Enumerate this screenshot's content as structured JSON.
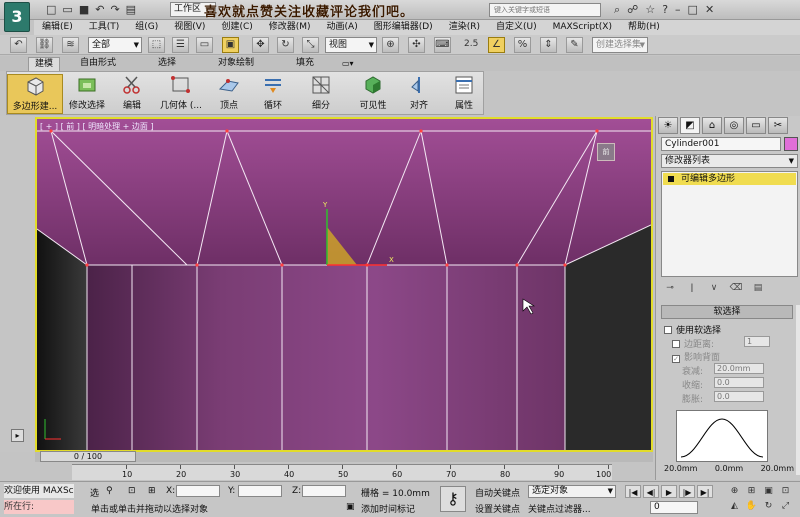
{
  "title_bar": {
    "app_logo": "3",
    "workspace_label": "工作区",
    "overlay_caption": "喜欢就点赞关注收藏评论我们吧。",
    "search_placeholder": "键入关键字或短语"
  },
  "menu": {
    "items": [
      "编辑(E)",
      "工具(T)",
      "组(G)",
      "视图(V)",
      "创建(C)",
      "修改器(M)",
      "动画(A)",
      "图形编辑器(D)",
      "渲染(R)",
      "自定义(U)",
      "MAXScript(X)",
      "帮助(H)"
    ]
  },
  "toolbar": {
    "selection_filter": "全部",
    "coord_system": "视图",
    "snap_value": "2.5",
    "named_selection_placeholder": "创建选择集"
  },
  "ribbon": {
    "tabs": [
      "建模",
      "自由形式",
      "选择",
      "对象绘制",
      "填充"
    ],
    "active_tab": "建模",
    "buttons": [
      {
        "label": "多边形建..."
      },
      {
        "label": "修改选择"
      },
      {
        "label": "编辑"
      },
      {
        "label": "几何体 (..."
      },
      {
        "label": "顶点"
      },
      {
        "label": "循环"
      },
      {
        "label": "细分"
      },
      {
        "label": "可见性"
      },
      {
        "label": "对齐"
      },
      {
        "label": "属性"
      }
    ]
  },
  "viewport": {
    "label": "[ + ] [ 前 ] [ 明暗处理 + 边面 ]",
    "viewcube_label": "前"
  },
  "command_panel": {
    "object_name": "Cylinder001",
    "object_color": "#e06fd8",
    "modifier_list": "修改器列表",
    "stack_item": "可编辑多边形",
    "rollout_title": "软选择",
    "use_soft_selection": "使用软选择",
    "edge_distance_label": "边距离:",
    "edge_distance_value": "1",
    "affect_backfacing": "影响背面",
    "falloff_label": "衰减:",
    "falloff_value": "20.0mm",
    "pinch_label": "收缩:",
    "pinch_value": "0.0",
    "bubble_label": "膨胀:",
    "bubble_value": "0.0",
    "curve_labels": [
      "20.0mm",
      "0.0mm",
      "20.0mm"
    ]
  },
  "timeline": {
    "time_slider": "0 / 100",
    "ticks": [
      "10",
      "20",
      "30",
      "40",
      "50",
      "60",
      "70",
      "80",
      "90",
      "100"
    ]
  },
  "status": {
    "welcome": "欢迎使用  MAXSc",
    "selection_status": "所在行:",
    "lock_label": "选",
    "x_label": "X:",
    "y_label": "Y:",
    "z_label": "Z:",
    "grid_label": "栅格 = 10.0mm",
    "hint": "单击或单击并拖动以选择对象",
    "add_time_tag": "添加时间标记",
    "auto_key": "自动关键点",
    "set_key": "设置关键点",
    "key_mode": "选定对象",
    "key_filters": "关键点过滤器...",
    "frame_value": "0"
  }
}
